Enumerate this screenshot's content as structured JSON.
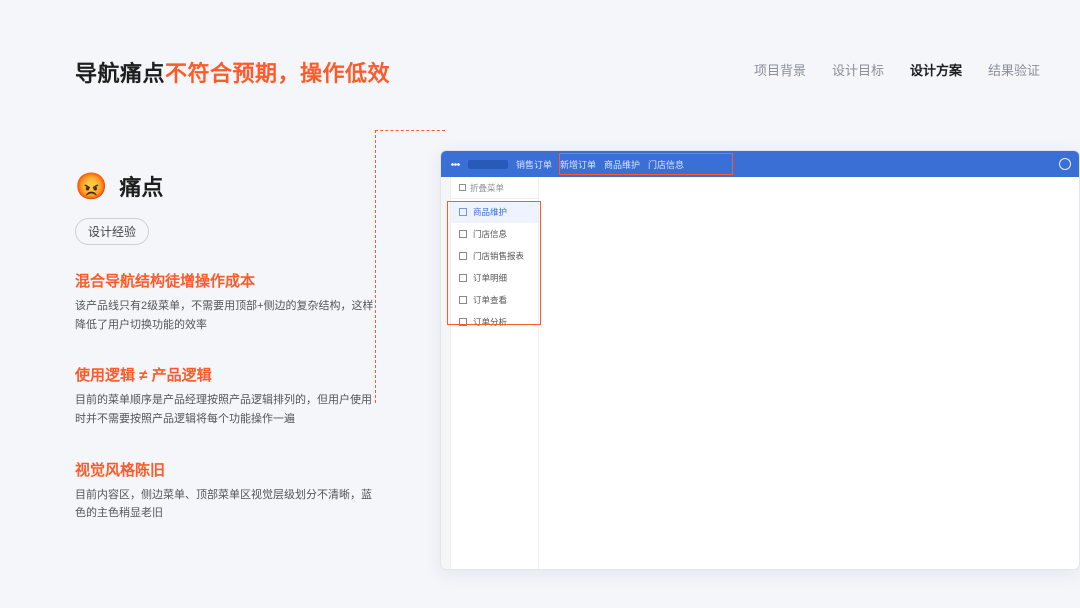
{
  "title": {
    "prefix": "导航痛点",
    "accent": "不符合预期，操作低效"
  },
  "nav": {
    "items": [
      "项目背景",
      "设计目标",
      "设计方案",
      "结果验证"
    ],
    "active_index": 2
  },
  "section": {
    "emoji": "😡",
    "label": "痛点",
    "tag": "设计经验"
  },
  "points": [
    {
      "h": "混合导航结构徒增操作成本",
      "p": "该产品线只有2级菜单，不需要用顶部+侧边的复杂结构，这样降低了用户切换功能的效率"
    },
    {
      "h": "使用逻辑 ≠ 产品逻辑",
      "p": "目前的菜单顺序是产品经理按照产品逻辑排列的，但用户使用时并不需要按照产品逻辑将每个功能操作一遍"
    },
    {
      "h": "视觉风格陈旧",
      "p": "目前内容区，侧边菜单、顶部菜单区视觉层级划分不清晰，蓝色的主色稍显老旧"
    }
  ],
  "mock": {
    "topbar": {
      "segs": [
        "销售订单",
        "新增订单",
        "商品维护",
        "门店信息"
      ],
      "side_header": "折叠菜单"
    },
    "side_items": [
      "商品维护",
      "门店信息",
      "门店销售报表",
      "订单明细",
      "订单查看",
      "订单分析"
    ],
    "side_active_index": 0
  }
}
